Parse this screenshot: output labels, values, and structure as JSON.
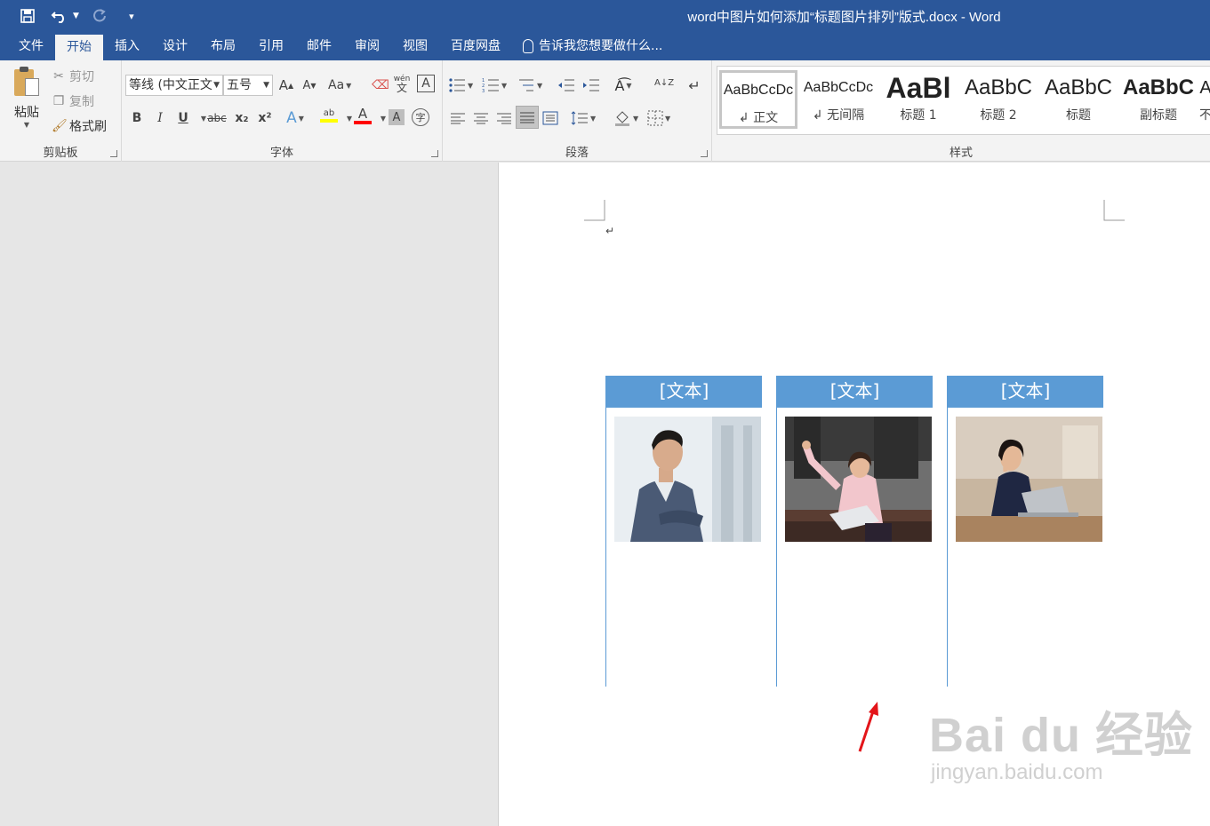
{
  "window": {
    "title": "word中图片如何添加“标题图片排列”版式.docx - Word"
  },
  "qat": {
    "save": "save-icon",
    "undo": "undo-icon",
    "redo": "redo-icon",
    "customize": "▾"
  },
  "tabs": [
    {
      "label": "文件"
    },
    {
      "label": "开始"
    },
    {
      "label": "插入"
    },
    {
      "label": "设计"
    },
    {
      "label": "布局"
    },
    {
      "label": "引用"
    },
    {
      "label": "邮件"
    },
    {
      "label": "审阅"
    },
    {
      "label": "视图"
    },
    {
      "label": "百度网盘"
    }
  ],
  "tellme": "告诉我您想要做什么...",
  "clipboard": {
    "paste": "粘贴",
    "cut": "剪切",
    "copy": "复制",
    "format_painter": "格式刷",
    "label": "剪贴板"
  },
  "font": {
    "name": "等线 (中文正文",
    "size": "五号",
    "grow": "A",
    "shrink": "A",
    "case": "Aa",
    "phonetic_top": "wén",
    "phonetic_bottom": "文",
    "border_char": "A",
    "bold": "B",
    "italic": "I",
    "underline": "U",
    "strike": "abc",
    "sub": "x₂",
    "sup": "x²",
    "effects": "A",
    "highlight": "ab",
    "color": "A",
    "shading": "A",
    "enclose": "字",
    "label": "字体",
    "highlight_color": "#ffff00",
    "font_color": "#ff0000"
  },
  "paragraph": {
    "label": "段落",
    "sort": "A↓Z",
    "pilcrow": "↵"
  },
  "styles": {
    "label": "样式",
    "items": [
      {
        "sample": "AaBbCcDc",
        "name": "↲ 正文"
      },
      {
        "sample": "AaBbCcDc",
        "name": "↲ 无间隔"
      },
      {
        "sample": "AaBl",
        "name": "标题 1"
      },
      {
        "sample": "AaBbC",
        "name": "标题 2"
      },
      {
        "sample": "AaBbC",
        "name": "标题"
      },
      {
        "sample": "AaBbC",
        "name": "副标题"
      },
      {
        "sample": "A",
        "name": "不"
      }
    ]
  },
  "document": {
    "cursor_mark": "↵",
    "panels": [
      {
        "heading": "[文本]",
        "photo": "man-in-suit-photo"
      },
      {
        "heading": "[文本]",
        "photo": "woman-celebrating-laptop-photo"
      },
      {
        "heading": "[文本]",
        "photo": "woman-at-laptop-photo"
      }
    ],
    "accent_color": "#5b9bd5"
  },
  "watermark": {
    "main": "Bai du 经验",
    "sub": "jingyan.baidu.com"
  }
}
